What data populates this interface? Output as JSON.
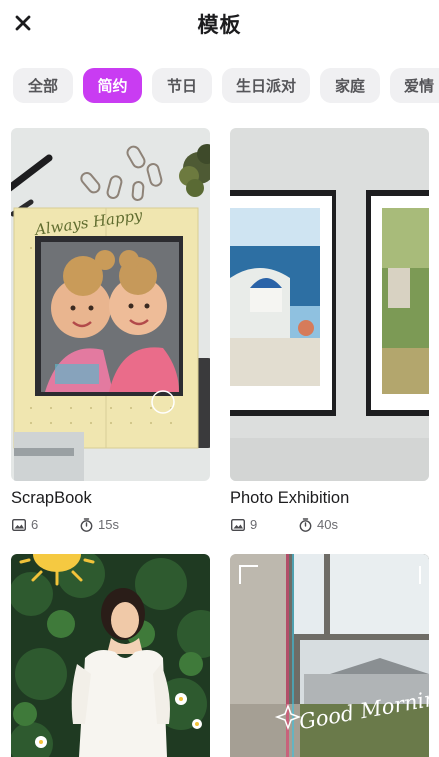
{
  "header": {
    "title": "模板",
    "close_icon": "close-icon"
  },
  "tabs": [
    {
      "label": "全部",
      "active": false
    },
    {
      "label": "简约",
      "active": true
    },
    {
      "label": "节日",
      "active": false
    },
    {
      "label": "生日派对",
      "active": false
    },
    {
      "label": "家庭",
      "active": false
    },
    {
      "label": "爱情",
      "active": false
    }
  ],
  "accent_color": "#c93cf2",
  "templates": [
    {
      "name": "ScrapBook",
      "photos": "6",
      "duration": "15s",
      "photo_text": "Always Happy"
    },
    {
      "name": "Photo Exhibition",
      "photos": "9",
      "duration": "40s"
    },
    {
      "name": "",
      "photos": "",
      "duration": ""
    },
    {
      "name": "",
      "photos": "",
      "duration": "",
      "photo_text": "Good Morning"
    }
  ],
  "icons": {
    "photos": "image-icon",
    "duration": "stopwatch-icon"
  }
}
